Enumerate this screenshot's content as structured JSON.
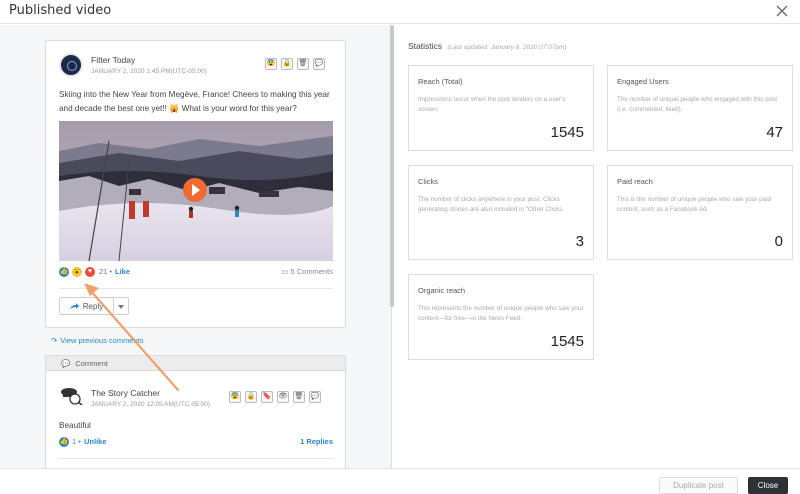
{
  "modal": {
    "title": "Published video"
  },
  "post": {
    "author": "Fitter Today",
    "time": "JANUARY 2, 2020 1:45 PM(UTC-05:00)",
    "text": "Skiing into the New Year from Megève, France! Cheers to making this year and decade the best one yet!! 🙀 What is your word for this year?",
    "reaction_count": "21 •",
    "like_label": "Like",
    "comments_label": "5 Comments",
    "reply_label": "Reply",
    "action_icons": [
      "stats-icon",
      "lock-icon",
      "trash-icon",
      "comment-icon"
    ]
  },
  "view_previous": "View previous comments",
  "comment_section": {
    "label": "Comment",
    "author": "The Story Catcher",
    "time": "JANUARY 2, 2020 12:05 AM(UTC-05:00)",
    "text": "Beautiful",
    "like_count": "1 •",
    "unlike_label": "Unlike",
    "replies_label": "1 Replies"
  },
  "statistics": {
    "title": "Statistics",
    "updated": "(Last updated: January 9, 2020 07:07pm)",
    "cards": [
      {
        "label": "Reach (Total)",
        "desc": "Impressions occur when the post renders on a user's screen.",
        "value": "1545"
      },
      {
        "label": "Engaged Users",
        "desc": "The number of unique people who engaged with this post (i.e. commented, liked).",
        "value": "47"
      },
      {
        "label": "Clicks",
        "desc": "The number of clicks anywhere in your post. Clicks generating stories are also included in \"Other Clicks.",
        "value": "3"
      },
      {
        "label": "Paid reach",
        "desc": "This is the number of unique people who saw your paid content, such as a Facebook Ad",
        "value": "0"
      },
      {
        "label": "Organic reach",
        "desc": "This represents the number of unique people who saw your content—for free—in the News Feed.",
        "value": "1545"
      }
    ]
  },
  "footer": {
    "duplicate_label": "Duplicate post",
    "close_label": "Close"
  },
  "colors": {
    "accent": "#2a86cf",
    "arrow": "#f0a06a",
    "play": "#ef6b33",
    "dark_button": "#2d3237"
  }
}
